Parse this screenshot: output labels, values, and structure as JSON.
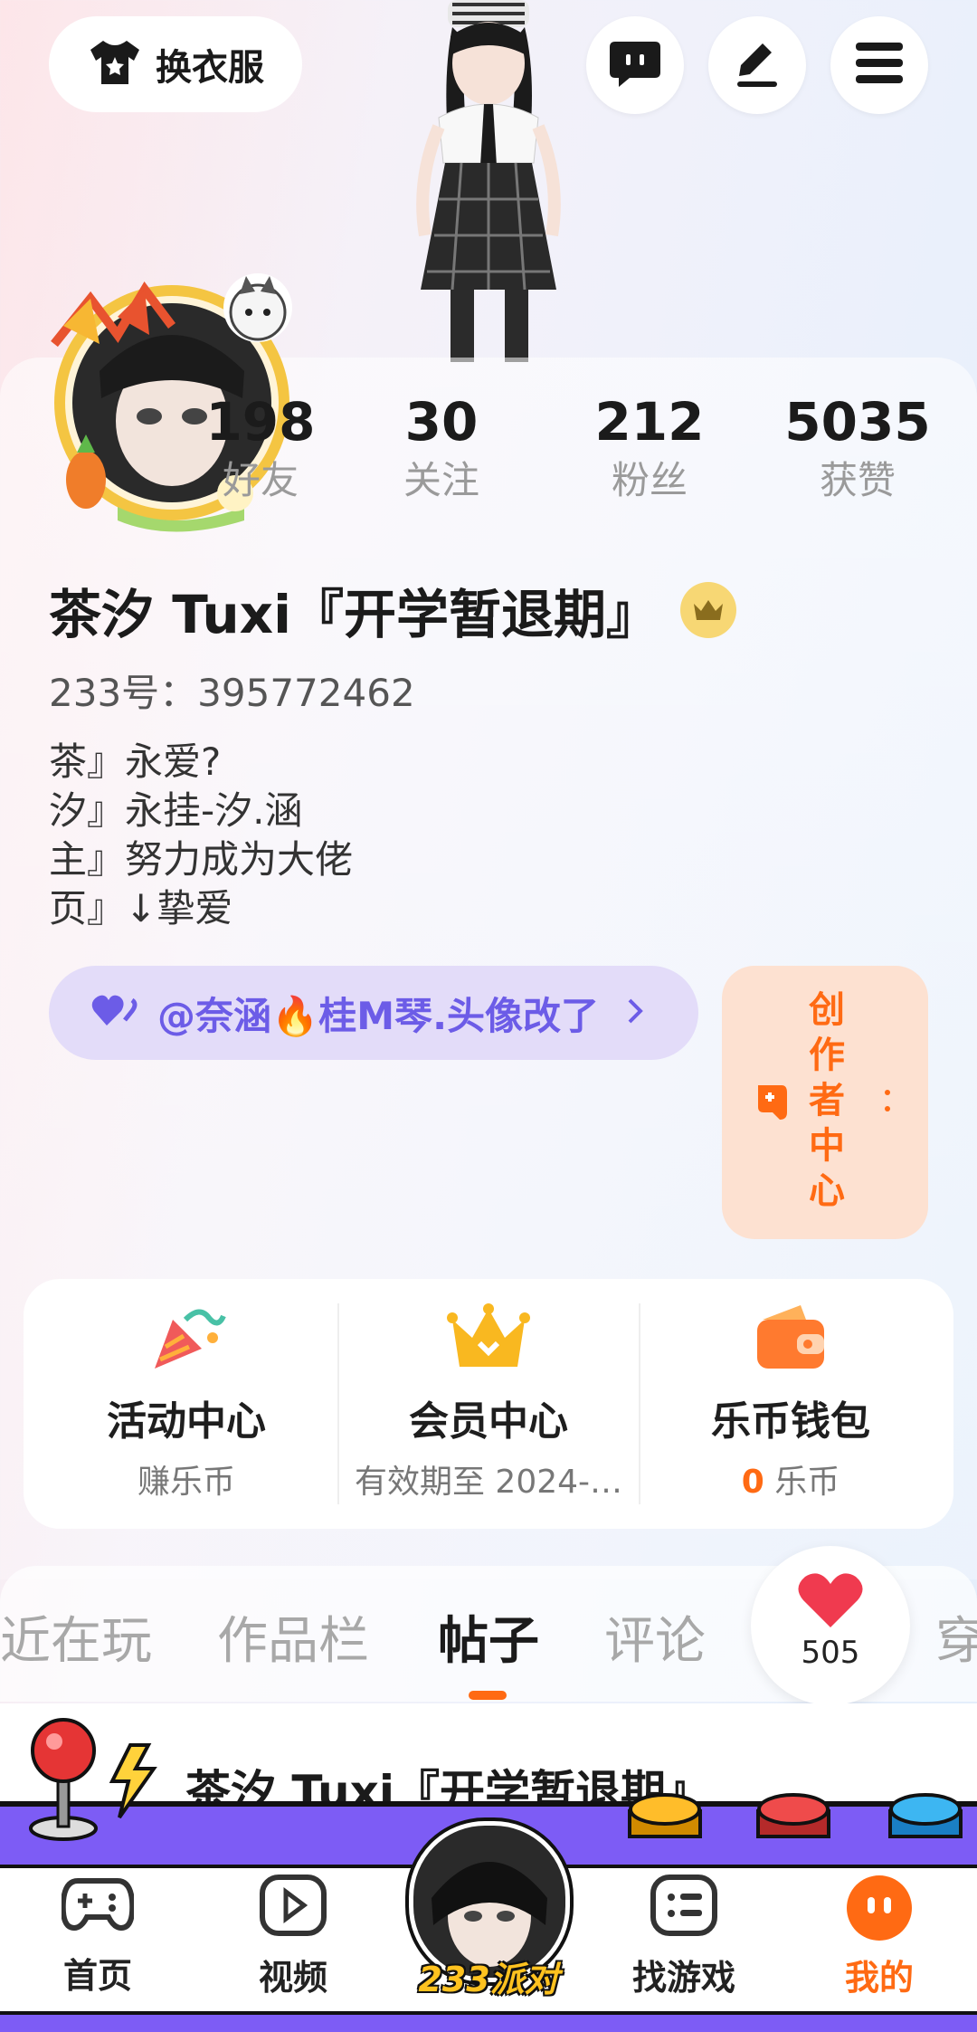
{
  "header": {
    "outfit_label": "换衣服"
  },
  "profile": {
    "name": "茶汐 Tuxi『开学暂退期』",
    "id_text": "233号：395772462",
    "bio_lines": [
      "茶』永爱?",
      "汐』永挂-汐.涵",
      "主』努力成为大佬",
      "页』↓挚爱"
    ],
    "stats": [
      {
        "value": "198",
        "label": "好友"
      },
      {
        "value": "30",
        "label": "关注"
      },
      {
        "value": "212",
        "label": "粉丝"
      },
      {
        "value": "5035",
        "label": "获赞"
      }
    ],
    "mention_text": "@奈涵🔥桂M琴.头像改了",
    "creator_center_label": "创作者中心"
  },
  "features": [
    {
      "title": "活动中心",
      "subtitle": "赚乐币"
    },
    {
      "title": "会员中心",
      "subtitle": "有效期至 2024-…"
    },
    {
      "title": "乐币钱包",
      "subtitle_count": "0",
      "subtitle_unit": "乐币"
    }
  ],
  "tabs": [
    {
      "label": "近在玩"
    },
    {
      "label": "作品栏"
    },
    {
      "label": "帖子",
      "active": true
    },
    {
      "label": "评论"
    },
    {
      "label": "穿"
    }
  ],
  "like_badge": {
    "count": "505"
  },
  "post_preview": {
    "title": "茶汐 Tuxi『开学暂退期』"
  },
  "bottom_nav": [
    {
      "label": "首页"
    },
    {
      "label": "视频"
    },
    {
      "label": "233派对"
    },
    {
      "label": "找游戏"
    },
    {
      "label": "我的",
      "active": true
    }
  ],
  "colors": {
    "accent_orange": "#ff6a13",
    "mention_purple": "#6c5ce7",
    "nav_purple": "#7d5cf5",
    "like_red": "#f03a4f"
  }
}
